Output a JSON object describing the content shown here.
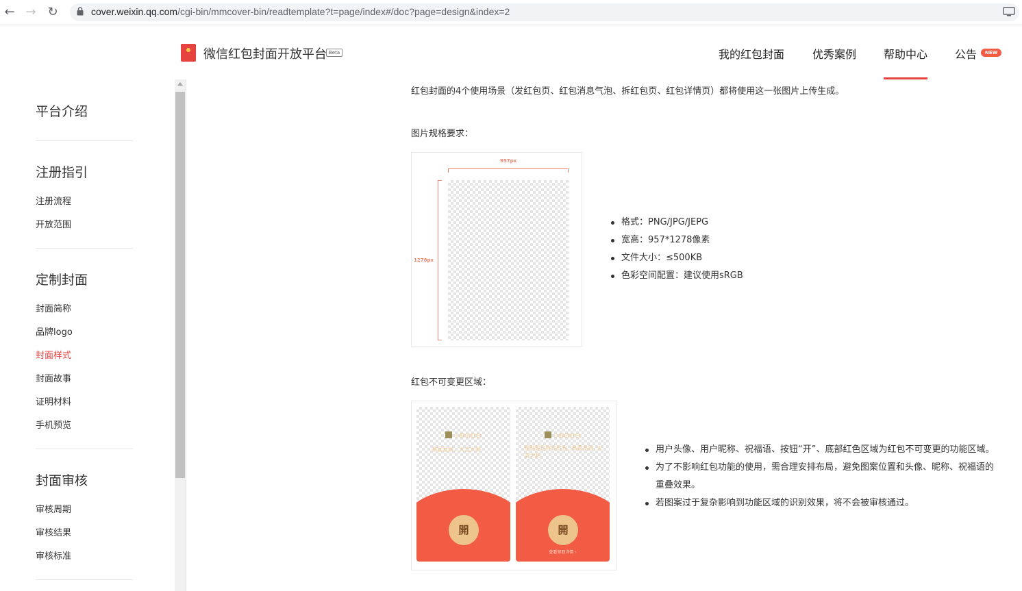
{
  "browser": {
    "back": "←",
    "forward": "→",
    "reload": "↻",
    "url_host": "cover.weixin.qq.com",
    "url_path": "/cgi-bin/mmcover-bin/readtemplate?t=page/index#/doc?page=design&index=2"
  },
  "header": {
    "site_title": "微信红包封面开放平台",
    "beta": "Beta",
    "nav": [
      "我的红包封面",
      "优秀案例",
      "帮助中心",
      "公告"
    ],
    "active_nav": "帮助中心",
    "new_badge": "NEW"
  },
  "sidebar": {
    "sections": [
      {
        "title": "平台介绍",
        "items": []
      },
      {
        "title": "注册指引",
        "items": [
          "注册流程",
          "开放范围"
        ]
      },
      {
        "title": "定制封面",
        "items": [
          "封面简称",
          "品牌logo",
          "封面样式",
          "封面故事",
          "证明材料",
          "手机预览"
        ]
      },
      {
        "title": "封面审核",
        "items": [
          "审核周期",
          "审核结果",
          "审核标准"
        ]
      }
    ],
    "active_item": "封面样式"
  },
  "content": {
    "intro": "红包封面的4个使用场景（发红包页、红包消息气泡、拆红包页、红包详情页）都将使用这一张图片上传生成。",
    "spec_heading": "图片规格要求：",
    "spec_width_label": "957px",
    "spec_height_label": "1278px",
    "spec_list": [
      "格式：PNG/JPG/JEPG",
      "宽高：957*1278像素",
      "文件大小：≤500KB",
      "色彩空间配置：建议使用sRGB"
    ],
    "area_heading": "红包不可变更区域：",
    "phone_left": {
      "name": "小胖的红包",
      "greeting": "恭喜发财，大吉大利",
      "button": "開"
    },
    "phone_right": {
      "name": "小胖的红包",
      "greeting": "规则是这样的红包, 恭喜发财, 大吉大利",
      "button": "開",
      "footer": "查看领取详情 ›"
    },
    "area_list": [
      "用户头像、用户昵称、祝福语、按钮“开”、底部红色区域为红包不可变更的功能区域。",
      "为了不影响红包功能的使用，需合理安排布局，避免图案位置和头像、昵称、祝福语的重叠效果。",
      "若图案过于复杂影响到功能区域的识别效果，将不会被审核通过。"
    ]
  },
  "colors": {
    "accent": "#e64340",
    "red_envelope": "#f25b44",
    "button_gold": "#edc48c"
  }
}
